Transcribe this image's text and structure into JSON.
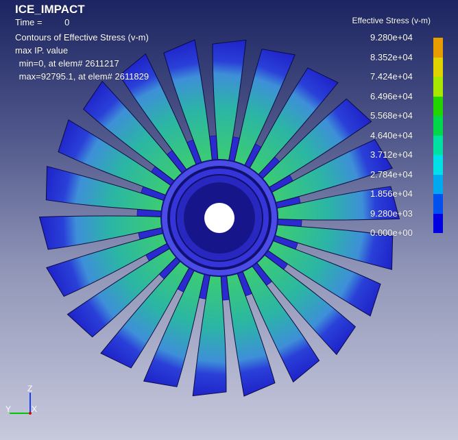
{
  "title": "ICE_IMPACT",
  "time_line": "Time =         0",
  "contours_line": "Contours of Effective Stress (v-m)",
  "value_mode": "max IP. value",
  "min_line": " min=0, at elem# 2611217",
  "max_line": " max=92795.1, at elem# 2611829",
  "fringe_title": "Effective Stress (v-m)",
  "legend": {
    "labels": [
      "9.280e+04",
      "8.352e+04",
      "7.424e+04",
      "6.496e+04",
      "5.568e+04",
      "4.640e+04",
      "3.712e+04",
      "2.784e+04",
      "1.856e+04",
      "9.280e+03",
      "0.000e+00"
    ],
    "colors": [
      "#e80000",
      "#e89c00",
      "#e0d400",
      "#a8e800",
      "#22d400",
      "#00d84a",
      "#00e0a0",
      "#00e0e8",
      "#00a8f0",
      "#0050f0",
      "#0000e0"
    ]
  },
  "triad": {
    "z_label": "Z",
    "y_label": "Y",
    "x_label": "X"
  },
  "model": {
    "blade_count": 22,
    "hub_color": "#3c3ce0",
    "tip_color": "#1e2ad0",
    "mid_color": "#2ea0c8",
    "root_color": "#2fb87a"
  }
}
